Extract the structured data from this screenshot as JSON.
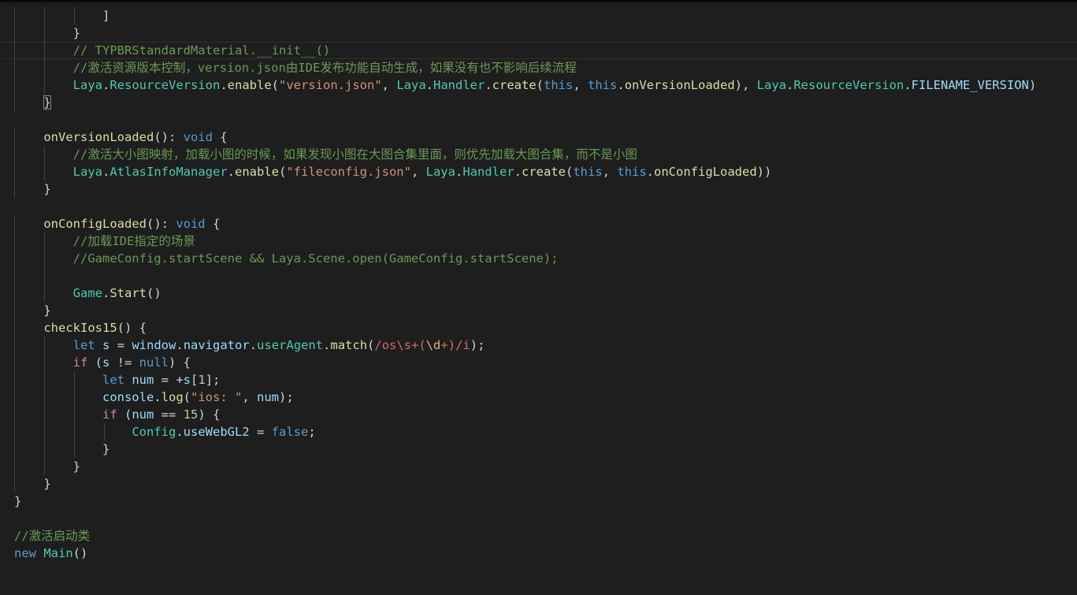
{
  "editor": {
    "theme_colors": {
      "background": "#1e1e1e",
      "keyword": "#569cd6",
      "string": "#ce9178",
      "comment": "#6a9955",
      "type": "#4ec9b0",
      "function": "#dcdcaa",
      "variable": "#9cdcfe",
      "number": "#b5cea8",
      "regex": "#d16969"
    },
    "lines": [
      {
        "indent": 3,
        "tokens": [
          {
            "t": "]",
            "c": "plain"
          }
        ]
      },
      {
        "indent": 2,
        "tokens": [
          {
            "t": "}",
            "c": "plain"
          }
        ]
      },
      {
        "indent": 2,
        "current": true,
        "tokens": [
          {
            "t": "// TYPBRStandardMaterial.__init__()",
            "c": "com"
          }
        ]
      },
      {
        "indent": 2,
        "tokens": [
          {
            "t": "//激活资源版本控制，version.json由IDE发布功能自动生成，如果没有也不影响后续流程",
            "c": "com"
          }
        ]
      },
      {
        "indent": 2,
        "tokens": [
          {
            "t": "Laya",
            "c": "ty"
          },
          {
            "t": ".",
            "c": "plain"
          },
          {
            "t": "ResourceVersion",
            "c": "ty"
          },
          {
            "t": ".",
            "c": "plain"
          },
          {
            "t": "enable",
            "c": "fn"
          },
          {
            "t": "(",
            "c": "plain"
          },
          {
            "t": "\"version.json\"",
            "c": "str"
          },
          {
            "t": ", ",
            "c": "plain"
          },
          {
            "t": "Laya",
            "c": "ty"
          },
          {
            "t": ".",
            "c": "plain"
          },
          {
            "t": "Handler",
            "c": "ty"
          },
          {
            "t": ".",
            "c": "plain"
          },
          {
            "t": "create",
            "c": "fn"
          },
          {
            "t": "(",
            "c": "plain"
          },
          {
            "t": "this",
            "c": "kw"
          },
          {
            "t": ", ",
            "c": "plain"
          },
          {
            "t": "this",
            "c": "kw"
          },
          {
            "t": ".",
            "c": "plain"
          },
          {
            "t": "onVersionLoaded",
            "c": "fn"
          },
          {
            "t": "), ",
            "c": "plain"
          },
          {
            "t": "Laya",
            "c": "ty"
          },
          {
            "t": ".",
            "c": "plain"
          },
          {
            "t": "ResourceVersion",
            "c": "ty"
          },
          {
            "t": ".",
            "c": "plain"
          },
          {
            "t": "FILENAME_VERSION",
            "c": "var"
          },
          {
            "t": ")",
            "c": "plain"
          }
        ]
      },
      {
        "indent": 1,
        "tokens": [
          {
            "t": "}",
            "c": "plain",
            "hl": true
          }
        ]
      },
      {
        "indent": 0,
        "tokens": []
      },
      {
        "indent": 1,
        "tokens": [
          {
            "t": "onVersionLoaded",
            "c": "fn"
          },
          {
            "t": "(): ",
            "c": "plain"
          },
          {
            "t": "void",
            "c": "kw"
          },
          {
            "t": " {",
            "c": "plain"
          }
        ]
      },
      {
        "indent": 2,
        "tokens": [
          {
            "t": "//激活大小图映射，加载小图的时候，如果发现小图在大图合集里面，则优先加载大图合集，而不是小图",
            "c": "com"
          }
        ]
      },
      {
        "indent": 2,
        "tokens": [
          {
            "t": "Laya",
            "c": "ty"
          },
          {
            "t": ".",
            "c": "plain"
          },
          {
            "t": "AtlasInfoManager",
            "c": "ty"
          },
          {
            "t": ".",
            "c": "plain"
          },
          {
            "t": "enable",
            "c": "fn"
          },
          {
            "t": "(",
            "c": "plain"
          },
          {
            "t": "\"fileconfig.json\"",
            "c": "str"
          },
          {
            "t": ", ",
            "c": "plain"
          },
          {
            "t": "Laya",
            "c": "ty"
          },
          {
            "t": ".",
            "c": "plain"
          },
          {
            "t": "Handler",
            "c": "ty"
          },
          {
            "t": ".",
            "c": "plain"
          },
          {
            "t": "create",
            "c": "fn"
          },
          {
            "t": "(",
            "c": "plain"
          },
          {
            "t": "this",
            "c": "kw"
          },
          {
            "t": ", ",
            "c": "plain"
          },
          {
            "t": "this",
            "c": "kw"
          },
          {
            "t": ".",
            "c": "plain"
          },
          {
            "t": "onConfigLoaded",
            "c": "fn"
          },
          {
            "t": "))",
            "c": "plain"
          }
        ]
      },
      {
        "indent": 1,
        "tokens": [
          {
            "t": "}",
            "c": "plain"
          }
        ]
      },
      {
        "indent": 0,
        "tokens": []
      },
      {
        "indent": 1,
        "tokens": [
          {
            "t": "onConfigLoaded",
            "c": "fn"
          },
          {
            "t": "(): ",
            "c": "plain"
          },
          {
            "t": "void",
            "c": "kw"
          },
          {
            "t": " {",
            "c": "plain"
          }
        ]
      },
      {
        "indent": 2,
        "tokens": [
          {
            "t": "//加载IDE指定的场景",
            "c": "com"
          }
        ]
      },
      {
        "indent": 2,
        "tokens": [
          {
            "t": "//GameConfig.startScene && Laya.Scene.open(GameConfig.startScene);",
            "c": "com"
          }
        ]
      },
      {
        "indent": 0,
        "guides": 2,
        "tokens": []
      },
      {
        "indent": 2,
        "tokens": [
          {
            "t": "Game",
            "c": "ty"
          },
          {
            "t": ".",
            "c": "plain"
          },
          {
            "t": "Start",
            "c": "fn"
          },
          {
            "t": "()",
            "c": "plain"
          }
        ]
      },
      {
        "indent": 1,
        "tokens": [
          {
            "t": "}",
            "c": "plain"
          }
        ]
      },
      {
        "indent": 1,
        "tokens": [
          {
            "t": "checkIos15",
            "c": "fn"
          },
          {
            "t": "() {",
            "c": "plain"
          }
        ]
      },
      {
        "indent": 2,
        "tokens": [
          {
            "t": "let",
            "c": "kw"
          },
          {
            "t": " ",
            "c": "plain"
          },
          {
            "t": "s",
            "c": "var"
          },
          {
            "t": " = ",
            "c": "plain"
          },
          {
            "t": "window",
            "c": "var"
          },
          {
            "t": ".",
            "c": "plain"
          },
          {
            "t": "navigator",
            "c": "var"
          },
          {
            "t": ".",
            "c": "plain"
          },
          {
            "t": "userAgent",
            "c": "ty"
          },
          {
            "t": ".",
            "c": "plain"
          },
          {
            "t": "match",
            "c": "fn"
          },
          {
            "t": "(",
            "c": "plain"
          },
          {
            "t": "/os\\s+(",
            "c": "re"
          },
          {
            "t": "\\d",
            "c": "esc"
          },
          {
            "t": "+",
            "c": "re"
          },
          {
            "t": ")/i",
            "c": "re"
          },
          {
            "t": ");",
            "c": "plain"
          }
        ]
      },
      {
        "indent": 2,
        "tokens": [
          {
            "t": "if",
            "c": "ctl"
          },
          {
            "t": " (",
            "c": "plain"
          },
          {
            "t": "s",
            "c": "var"
          },
          {
            "t": " != ",
            "c": "plain"
          },
          {
            "t": "null",
            "c": "kw"
          },
          {
            "t": ") {",
            "c": "plain"
          }
        ]
      },
      {
        "indent": 3,
        "tokens": [
          {
            "t": "let",
            "c": "kw"
          },
          {
            "t": " ",
            "c": "plain"
          },
          {
            "t": "num",
            "c": "var"
          },
          {
            "t": " = +",
            "c": "plain"
          },
          {
            "t": "s",
            "c": "var"
          },
          {
            "t": "[",
            "c": "plain"
          },
          {
            "t": "1",
            "c": "num"
          },
          {
            "t": "];",
            "c": "plain"
          }
        ]
      },
      {
        "indent": 3,
        "tokens": [
          {
            "t": "console",
            "c": "var"
          },
          {
            "t": ".",
            "c": "plain"
          },
          {
            "t": "log",
            "c": "fn"
          },
          {
            "t": "(",
            "c": "plain"
          },
          {
            "t": "\"ios: \"",
            "c": "str"
          },
          {
            "t": ", ",
            "c": "plain"
          },
          {
            "t": "num",
            "c": "var"
          },
          {
            "t": ");",
            "c": "plain"
          }
        ]
      },
      {
        "indent": 3,
        "tokens": [
          {
            "t": "if",
            "c": "ctl"
          },
          {
            "t": " (",
            "c": "plain"
          },
          {
            "t": "num",
            "c": "var"
          },
          {
            "t": " == ",
            "c": "plain"
          },
          {
            "t": "15",
            "c": "num"
          },
          {
            "t": ") {",
            "c": "plain"
          }
        ]
      },
      {
        "indent": 4,
        "tokens": [
          {
            "t": "Config",
            "c": "ty"
          },
          {
            "t": ".",
            "c": "plain"
          },
          {
            "t": "useWebGL2",
            "c": "var"
          },
          {
            "t": " = ",
            "c": "plain"
          },
          {
            "t": "false",
            "c": "kw"
          },
          {
            "t": ";",
            "c": "plain"
          }
        ]
      },
      {
        "indent": 3,
        "tokens": [
          {
            "t": "}",
            "c": "plain"
          }
        ]
      },
      {
        "indent": 2,
        "tokens": [
          {
            "t": "}",
            "c": "plain"
          }
        ]
      },
      {
        "indent": 1,
        "tokens": [
          {
            "t": "}",
            "c": "plain"
          }
        ]
      },
      {
        "indent": 0,
        "tokens": [
          {
            "t": "}",
            "c": "plain"
          }
        ]
      },
      {
        "indent": 0,
        "noguide": true,
        "tokens": []
      },
      {
        "indent": 0,
        "noguide": true,
        "tokens": [
          {
            "t": "//激活启动类",
            "c": "com"
          }
        ]
      },
      {
        "indent": 0,
        "noguide": true,
        "tokens": [
          {
            "t": "new",
            "c": "kw"
          },
          {
            "t": " ",
            "c": "plain"
          },
          {
            "t": "Main",
            "c": "ty"
          },
          {
            "t": "()",
            "c": "plain"
          }
        ]
      }
    ]
  }
}
